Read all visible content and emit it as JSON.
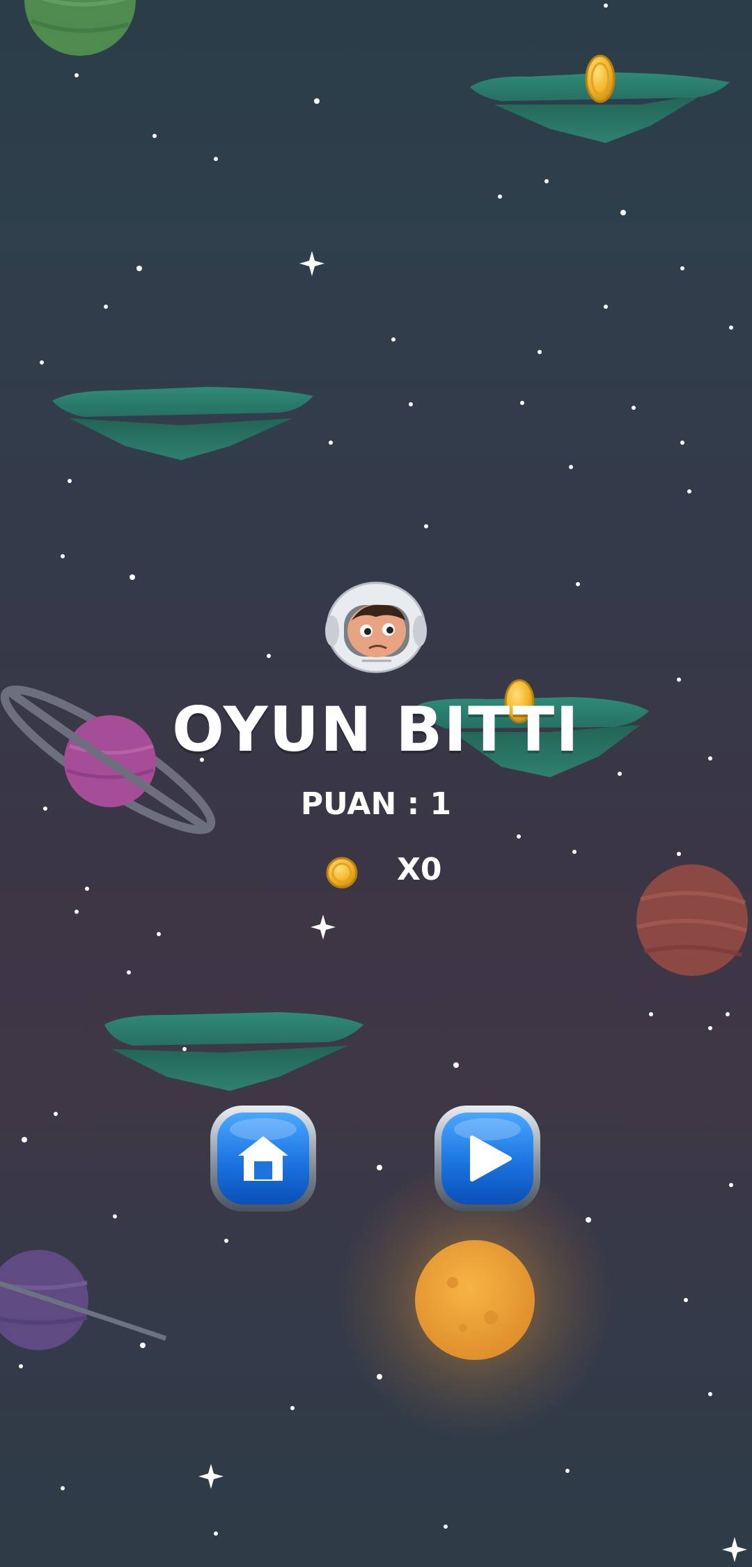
{
  "game_over": {
    "title": "OYUN BITTI",
    "score_text": "PUAN : 1",
    "coin_count_text": "X0"
  },
  "buttons": {
    "home": {
      "icon": "home-icon"
    },
    "play": {
      "icon": "play-icon"
    }
  },
  "colors": {
    "button_blue": "#1f7be0",
    "coin_gold": "#f0b62c",
    "platform_teal": "#2e7a6c"
  }
}
